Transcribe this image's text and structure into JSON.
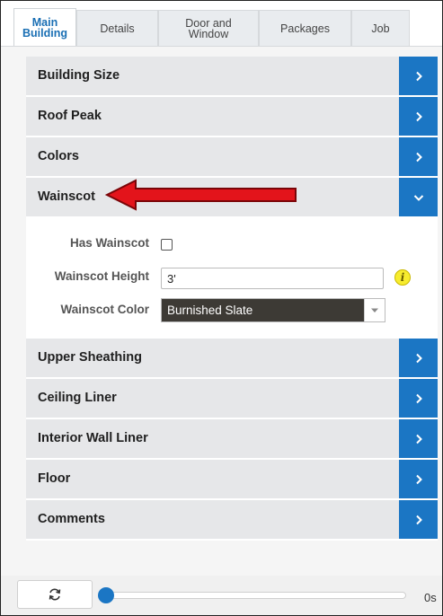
{
  "tabs": [
    {
      "label": "Main\nBuilding",
      "active": true
    },
    {
      "label": "Details",
      "active": false
    },
    {
      "label": "Door and\nWindow",
      "active": false
    },
    {
      "label": "Packages",
      "active": false
    },
    {
      "label": "Job",
      "active": false
    }
  ],
  "sections_top": [
    {
      "label": "Building Size"
    },
    {
      "label": "Roof Peak"
    },
    {
      "label": "Colors"
    }
  ],
  "wainscot": {
    "label": "Wainscot",
    "has_wainscot_label": "Has Wainscot",
    "has_wainscot_checked": false,
    "height_label": "Wainscot Height",
    "height_value": "3'",
    "color_label": "Wainscot Color",
    "color_value": "Burnished Slate",
    "info_icon": "i"
  },
  "sections_bottom": [
    {
      "label": "Upper Sheathing"
    },
    {
      "label": "Ceiling Liner"
    },
    {
      "label": "Interior Wall Liner"
    },
    {
      "label": "Floor"
    },
    {
      "label": "Comments"
    }
  ],
  "bottom_bar": {
    "time_label": "0s",
    "slider_value": 0
  },
  "colors": {
    "accent": "#1b76c4",
    "annotation_arrow": "#e3141b"
  }
}
